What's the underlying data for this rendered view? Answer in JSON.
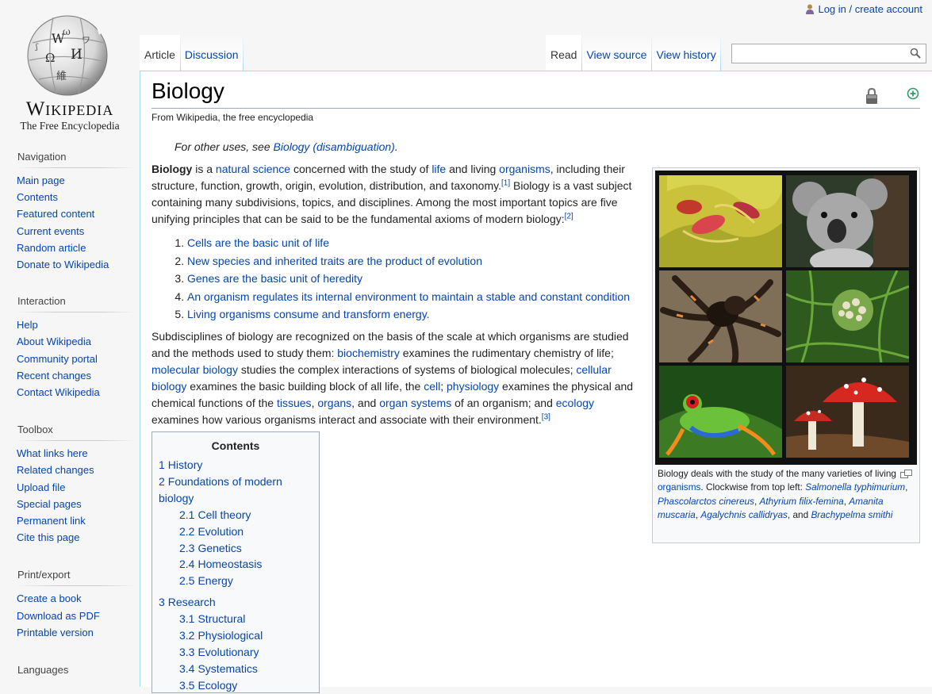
{
  "logo": {
    "wordmark": "Wikipedia",
    "tagline": "The Free Encyclopedia"
  },
  "personal": {
    "login_label": "Log in / create account"
  },
  "tabs": {
    "left": [
      {
        "label": "Article",
        "selected": true
      },
      {
        "label": "Discussion",
        "selected": false
      }
    ],
    "right": [
      {
        "label": "Read",
        "selected": true
      },
      {
        "label": "View source",
        "selected": false
      },
      {
        "label": "View history",
        "selected": false
      }
    ]
  },
  "search": {
    "placeholder": "",
    "value": ""
  },
  "article": {
    "title": "Biology",
    "site_sub": "From Wikipedia, the free encyclopedia",
    "hatnote": {
      "prefix": "For other uses, see ",
      "link": "Biology (disambiguation)",
      "suffix": "."
    },
    "intro": {
      "bold": "Biology",
      "t1": " is a ",
      "l1": "natural science",
      "t2": " concerned with the study of ",
      "l2": "life",
      "t3": " and living ",
      "l3": "organisms",
      "t4": ", including their structure, function, growth, origin, evolution, distribution, and taxonomy.",
      "ref1": "[1]",
      "t5": " Biology is a vast subject containing many subdivisions, topics, and disciplines. Among the most important topics are five unifying principles that can be said to be the fundamental axioms of modern biology:",
      "ref2": "[2]"
    },
    "principles": [
      "Cells are the basic unit of life",
      "New species and inherited traits are the product of evolution",
      "Genes are the basic unit of heredity",
      "An organism regulates its internal environment to maintain a stable and constant condition",
      "Living organisms consume and transform energy."
    ],
    "para2": {
      "t1": "Subdisciplines of biology are recognized on the basis of the scale at which organisms are studied and the methods used to study them: ",
      "l1": "biochemistry",
      "t2": " examines the rudimentary chemistry of life; ",
      "l2": "molecular biology",
      "t3": " studies the complex interactions of systems of biological molecules; ",
      "l3": "cellular biology",
      "t4": " examines the basic building block of all life, the ",
      "l4": "cell",
      "t5": "; ",
      "l5": "physiology",
      "t6": " examines the physical and chemical functions of the ",
      "l6": "tissues",
      "t7": ", ",
      "l7": "organs",
      "t8": ", and ",
      "l8": "organ systems",
      "t9": " of an organism; and ",
      "l9": "ecology",
      "t10": " examines how various organisms interact and associate with their environment.",
      "ref3": "[3]"
    },
    "thumb": {
      "caption_t1": "Biology deals with the study of the many varieties of living ",
      "caption_link": "organisms",
      "caption_t2": ". Clockwise from top left: ",
      "s1": "Salmonella typhimurium",
      "s2": "Phascolarctos cinereus",
      "s3": "Athyrium filix-femina",
      "s4": "Amanita muscaria",
      "s5": "Agalychnis callidryas",
      "s6": "Brachypelma smithi",
      "sep": ", ",
      "and": ", and "
    },
    "toc": {
      "title": "Contents",
      "items": [
        {
          "num": "1",
          "label": "History"
        },
        {
          "num": "2",
          "label": "Foundations of modern biology"
        },
        {
          "num": "2.1",
          "label": "Cell theory"
        },
        {
          "num": "2.2",
          "label": "Evolution"
        },
        {
          "num": "2.3",
          "label": "Genetics"
        },
        {
          "num": "2.4",
          "label": "Homeostasis"
        },
        {
          "num": "2.5",
          "label": "Energy"
        },
        {
          "num": "3",
          "label": "Research"
        },
        {
          "num": "3.1",
          "label": "Structural"
        },
        {
          "num": "3.2",
          "label": "Physiological"
        },
        {
          "num": "3.3",
          "label": "Evolutionary"
        },
        {
          "num": "3.4",
          "label": "Systematics"
        },
        {
          "num": "3.5",
          "label": "Ecology"
        }
      ]
    }
  },
  "sidebar": {
    "navigation": {
      "title": "Navigation",
      "items": [
        "Main page",
        "Contents",
        "Featured content",
        "Current events",
        "Random article",
        "Donate to Wikipedia"
      ]
    },
    "interaction": {
      "title": "Interaction",
      "items": [
        "Help",
        "About Wikipedia",
        "Community portal",
        "Recent changes",
        "Contact Wikipedia"
      ]
    },
    "toolbox": {
      "title": "Toolbox",
      "items": [
        "What links here",
        "Related changes",
        "Upload file",
        "Special pages",
        "Permanent link",
        "Cite this page"
      ]
    },
    "print": {
      "title": "Print/export",
      "items": [
        "Create a book",
        "Download as PDF",
        "Printable version"
      ]
    },
    "languages": {
      "title": "Languages"
    }
  },
  "colors": {
    "link": "#0645ad",
    "border": "#a7d7f9",
    "page_bg": "#f6f6f6"
  }
}
